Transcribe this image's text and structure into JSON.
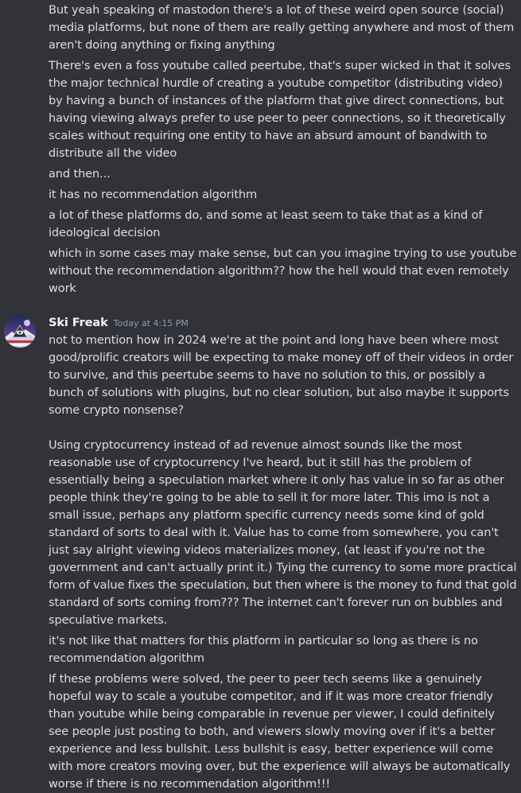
{
  "messages_previous": [
    "But yeah speaking of mastodon there's a lot of these weird open source (social) media platforms, but none of them are really getting anywhere and most of them aren't doing anything or fixing anything",
    "There's even a foss youtube called peertube, that's super wicked in that it solves the major technical hurdle of creating a youtube competitor (distributing video) by having a bunch of instances of the platform that give direct connections, but having viewing always prefer to use peer to peer connections, so it theoretically scales without requiring one entity to have an absurd amount of bandwith to distribute all the video",
    "and then...",
    "it has no recommendation algorithm",
    "a lot of these platforms do, and some at least seem to take that as a kind of ideological decision",
    "which in some cases may make sense, but can you imagine trying to use youtube without the recommendation algorithm?? how the hell would that even remotely work"
  ],
  "author": {
    "name": "Ski Freak",
    "timestamp": "Today at 4:15 PM"
  },
  "messages_author": {
    "first_para1": "not to mention how in 2024 we're at the point and long have been where most good/prolific creators will be expecting to make money off of their videos in order to survive, and this peertube seems to have no solution to this, or possibly a bunch of solutions with plugins, but no clear solution, but also maybe it supports some crypto nonsense?",
    "first_para2": "Using cryptocurrency instead of ad revenue almost sounds like the most reasonable use of cryptocurrency I've heard, but it still has the problem of essentially being a speculation market where it only has value in so far as other people think they're going to be able to sell it for more later. This imo is not a small issue, perhaps any platform specific currency needs some kind of gold standard of sorts to deal with it. Value has to come from somewhere, you can't just say alright viewing videos materializes money, (at least if you're not the government and can't actually print it.) Tying the currency to some more practical form of value fixes the speculation, but then where is the money to fund that gold standard of sorts coming from??? The internet can't forever run on bubbles and speculative markets.",
    "second": "it's not like that matters for this platform in particular so long as there is no recommendation algorithm",
    "third": "If these problems were solved, the peer to peer tech seems like a genuinely hopeful way to scale a youtube competitor, and if it was more creator friendly than youtube while being comparable in revenue per viewer, I could definitely see people just posting to both, and viewers slowly moving over if it's a better experience and less bullshit. Less bullshit is easy, better experience will come with more creators moving over, but the experience will always be automatically worse if there is no recommendation algorithm!!!"
  },
  "colors": {
    "background": "#313338",
    "text": "#dbdee1",
    "username": "#f2f3f5",
    "timestamp": "#949ba4"
  },
  "icons": {
    "avatar": "avatar-icon"
  }
}
